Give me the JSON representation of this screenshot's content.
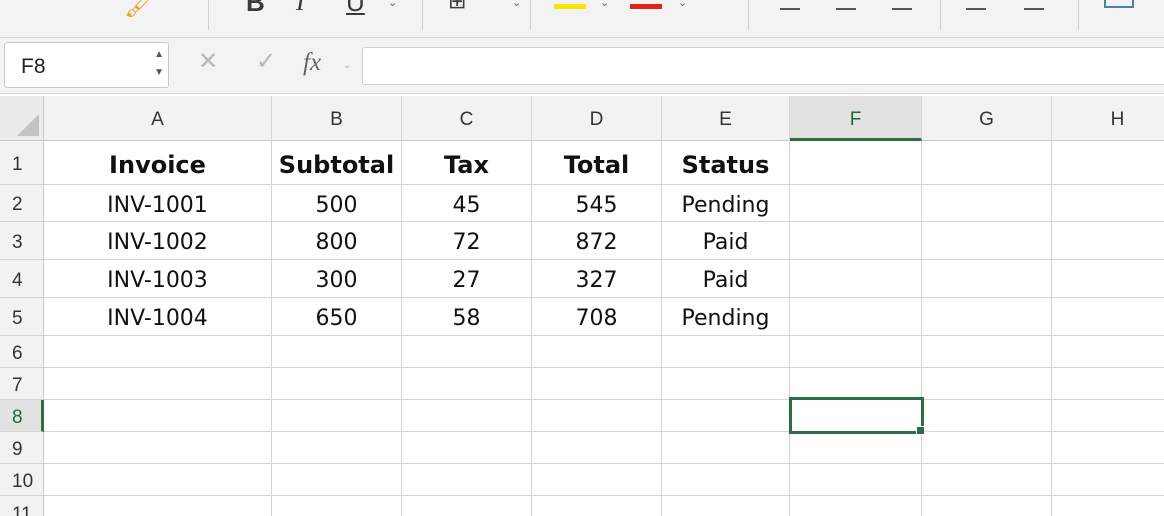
{
  "app": {
    "accent_color": "#2c6e3f"
  },
  "ribbon": {
    "glyphs": [
      {
        "name": "format-painter-icon",
        "glyph": "🖌"
      },
      {
        "name": "bold-icon",
        "glyph": "B"
      },
      {
        "name": "italic-icon",
        "glyph": "I"
      },
      {
        "name": "underline-icon",
        "glyph": "U"
      },
      {
        "name": "borders-icon",
        "glyph": "⊞"
      },
      {
        "name": "highlight-icon",
        "glyph": "✎"
      },
      {
        "name": "font-color-icon",
        "glyph": "A"
      }
    ],
    "highlight_color": "#f7e600",
    "font_color": "#e2231a"
  },
  "formula_bar": {
    "name_box_value": "F8",
    "fx_label": "fx",
    "cancel_icon": "close-icon",
    "confirm_icon": "checkmark-icon",
    "formula_value": ""
  },
  "columns": [
    "A",
    "B",
    "C",
    "D",
    "E",
    "F",
    "G",
    "H"
  ],
  "selected_column": "F",
  "rows": [
    "1",
    "2",
    "3",
    "4",
    "5",
    "6",
    "7",
    "8",
    "9",
    "10",
    "11"
  ],
  "selected_row": "8",
  "table": {
    "header": [
      "Invoice",
      "Subtotal",
      "Tax",
      "Total",
      "Status"
    ],
    "data": [
      [
        "INV-1001",
        "500",
        "45",
        "545",
        "Pending"
      ],
      [
        "INV-1002",
        "800",
        "72",
        "872",
        "Paid"
      ],
      [
        "INV-1003",
        "300",
        "27",
        "327",
        "Paid"
      ],
      [
        "INV-1004",
        "650",
        "58",
        "708",
        "Pending"
      ]
    ]
  },
  "active_cell": "F8"
}
